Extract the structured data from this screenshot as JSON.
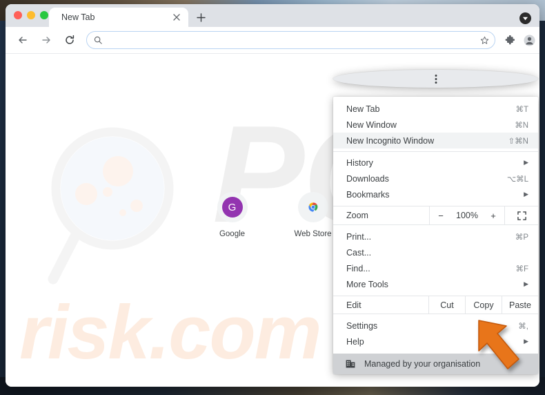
{
  "window": {
    "traffic_lights": [
      "close",
      "minimize",
      "maximize"
    ],
    "tab": {
      "title": "New Tab",
      "close_icon": "close-icon"
    },
    "new_tab_button": "+",
    "right_badge_icon": "download-badge-icon"
  },
  "toolbar": {
    "back_icon": "back-arrow-icon",
    "forward_icon": "forward-arrow-icon",
    "reload_icon": "reload-icon",
    "omnibox": {
      "value": "",
      "placeholder": "",
      "search_icon": "search-icon",
      "star_icon": "bookmark-star-icon"
    },
    "extensions_icon": "puzzle-piece-icon",
    "profile_icon": "profile-avatar-icon",
    "menu_icon": "three-dot-menu-icon"
  },
  "newtab": {
    "watermark_large": "PC",
    "watermark_small": "risk.com",
    "shortcuts": [
      {
        "label": "Google",
        "badge": "G",
        "icon": "google-g-icon"
      },
      {
        "label": "Web Store",
        "icon": "chrome-webstore-icon"
      }
    ]
  },
  "menu": {
    "items": [
      {
        "label": "New Tab",
        "accel": "⌘T",
        "hover": false,
        "arrow": false
      },
      {
        "label": "New Window",
        "accel": "⌘N",
        "hover": false,
        "arrow": false
      },
      {
        "label": "New Incognito Window",
        "accel": "⇧⌘N",
        "hover": true,
        "arrow": false
      }
    ],
    "items2": [
      {
        "label": "History",
        "accel": "",
        "arrow": true
      },
      {
        "label": "Downloads",
        "accel": "⌥⌘L",
        "arrow": false
      },
      {
        "label": "Bookmarks",
        "accel": "",
        "arrow": true
      }
    ],
    "zoom": {
      "label": "Zoom",
      "minus": "−",
      "value": "100%",
      "plus": "+",
      "fullscreen_icon": "fullscreen-icon"
    },
    "items3": [
      {
        "label": "Print...",
        "accel": "⌘P",
        "arrow": false
      },
      {
        "label": "Cast...",
        "accel": "",
        "arrow": false
      },
      {
        "label": "Find...",
        "accel": "⌘F",
        "arrow": false
      },
      {
        "label": "More Tools",
        "accel": "",
        "arrow": true
      }
    ],
    "edit": {
      "label": "Edit",
      "cut": "Cut",
      "copy": "Copy",
      "paste": "Paste"
    },
    "items4": [
      {
        "label": "Settings",
        "accel": "⌘,",
        "arrow": false
      },
      {
        "label": "Help",
        "accel": "",
        "arrow": true
      }
    ],
    "managed": {
      "label": "Managed by your organisation",
      "icon": "organisation-building-icon"
    }
  },
  "annotation": {
    "pointer_icon": "orange-arrow-pointer",
    "color": "#e8751a"
  },
  "colors": {
    "tabstrip": "#dee1e6",
    "accent_blue": "#b9d3f2",
    "menu_hover": "#f1f3f4",
    "managed_bar": "#cfd1d4",
    "google_purple": "#9334b0",
    "watermark_peach": "#fdece0",
    "arrow_orange": "#e8751a"
  }
}
